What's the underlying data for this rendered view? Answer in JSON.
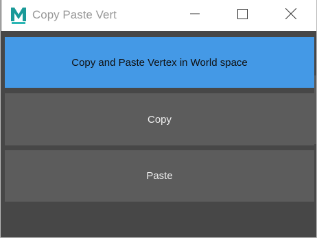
{
  "window": {
    "title": "Copy Paste Vert",
    "icon": "maya-app-icon",
    "controls": [
      "minimize-icon",
      "maximize-icon",
      "close-icon"
    ]
  },
  "header": {
    "text": "Copy and Paste Vertex in World space"
  },
  "buttons": {
    "copy_label": "Copy",
    "paste_label": "Paste"
  },
  "colors": {
    "header_bg": "#4499e6",
    "button_bg": "#5c5c5c",
    "window_bg": "#474747",
    "icon_teal": "#1a9a98"
  }
}
